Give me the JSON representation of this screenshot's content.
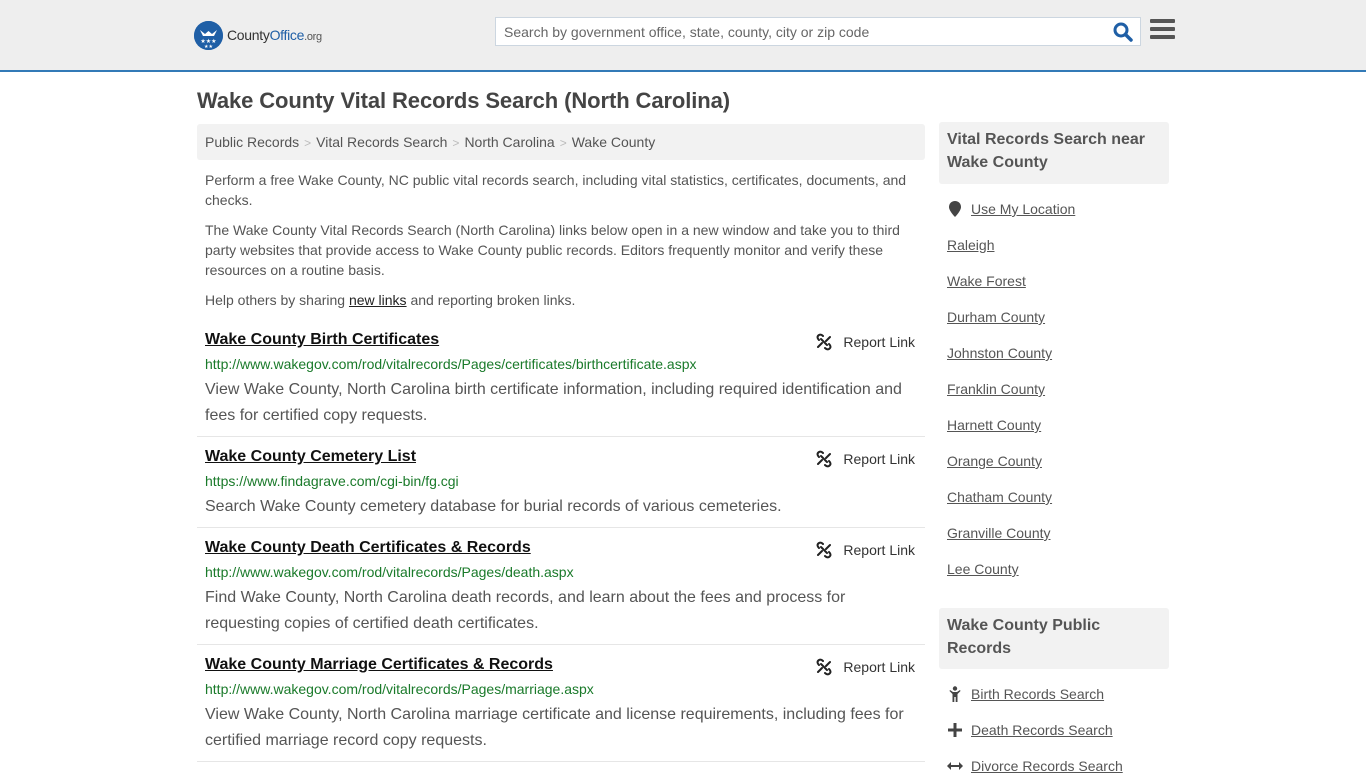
{
  "header": {
    "logo_text_1": "County",
    "logo_text_2": "Office",
    "logo_text_3": ".org",
    "search_placeholder": "Search by government office, state, county, city or zip code",
    "search_icon": "search-icon",
    "menu_icon": "hamburger-menu-icon",
    "accent_color": "#337ab7"
  },
  "page": {
    "title": "Wake County Vital Records Search (North Carolina)"
  },
  "breadcrumb": [
    {
      "label": "Public Records"
    },
    {
      "label": "Vital Records Search"
    },
    {
      "label": "North Carolina"
    },
    {
      "label": "Wake County"
    }
  ],
  "intro": {
    "p1": "Perform a free Wake County, NC public vital records search, including vital statistics, certificates, documents, and checks.",
    "p2": "The Wake County Vital Records Search (North Carolina) links below open in a new window and take you to third party websites that provide access to Wake County public records. Editors frequently monitor and verify these resources on a routine basis.",
    "p3_before": "Help others by sharing ",
    "p3_link": "new links",
    "p3_after": " and reporting broken links."
  },
  "results": [
    {
      "title": "Wake County Birth Certificates",
      "url": "http://www.wakegov.com/rod/vitalrecords/Pages/certificates/birthcertificate.aspx",
      "description": "View Wake County, North Carolina birth certificate information, including required identification and fees for certified copy requests.",
      "report_label": "Report Link"
    },
    {
      "title": "Wake County Cemetery List",
      "url": "https://www.findagrave.com/cgi-bin/fg.cgi",
      "description": "Search Wake County cemetery database for burial records of various cemeteries.",
      "report_label": "Report Link"
    },
    {
      "title": "Wake County Death Certificates & Records",
      "url": "http://www.wakegov.com/rod/vitalrecords/Pages/death.aspx",
      "description": "Find Wake County, North Carolina death records, and learn about the fees and process for requesting copies of certified death certificates.",
      "report_label": "Report Link"
    },
    {
      "title": "Wake County Marriage Certificates & Records",
      "url": "http://www.wakegov.com/rod/vitalrecords/Pages/marriage.aspx",
      "description": "View Wake County, North Carolina marriage certificate and license requirements, including fees for certified marriage record copy requests.",
      "report_label": "Report Link"
    }
  ],
  "sidebar": {
    "nearby_heading": "Vital Records Search near Wake County",
    "use_location": "Use My Location",
    "nearby": [
      "Raleigh",
      "Wake Forest",
      "Durham County",
      "Johnston County",
      "Franklin County",
      "Harnett County",
      "Orange County",
      "Chatham County",
      "Granville County",
      "Lee County"
    ],
    "public_heading": "Wake County Public Records",
    "public_records": [
      {
        "label": "Birth Records Search",
        "icon": "child-icon"
      },
      {
        "label": "Death Records Search",
        "icon": "plus-icon"
      },
      {
        "label": "Divorce Records Search",
        "icon": "arrows-horizontal-icon"
      }
    ]
  }
}
